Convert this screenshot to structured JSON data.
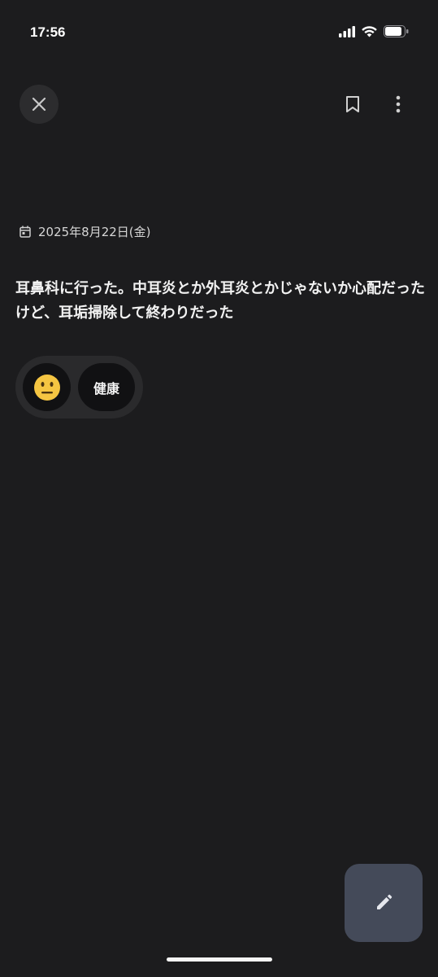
{
  "status_bar": {
    "time": "17:56",
    "icons": [
      "signal-icon",
      "wifi-icon",
      "battery-icon"
    ]
  },
  "toolbar": {
    "close_icon": "close-icon",
    "bookmark_icon": "bookmark-outline-icon",
    "more_icon": "more-vertical-icon"
  },
  "entry": {
    "date_icon": "calendar-icon",
    "date": "2025年8月22日(金)",
    "text": "耳鼻科に行った。中耳炎とか外耳炎とかじゃないか心配だったけど、耳垢掃除して終わりだった",
    "mood_icon": "neutral-face-emoji",
    "tags": [
      "健康"
    ]
  },
  "fab": {
    "icon": "pencil-icon"
  },
  "colors": {
    "background": "#1c1c1e",
    "chip_group": "#2a2a2c",
    "chip": "#111113",
    "fab": "#444a59",
    "mood_face": "#f5c542"
  }
}
